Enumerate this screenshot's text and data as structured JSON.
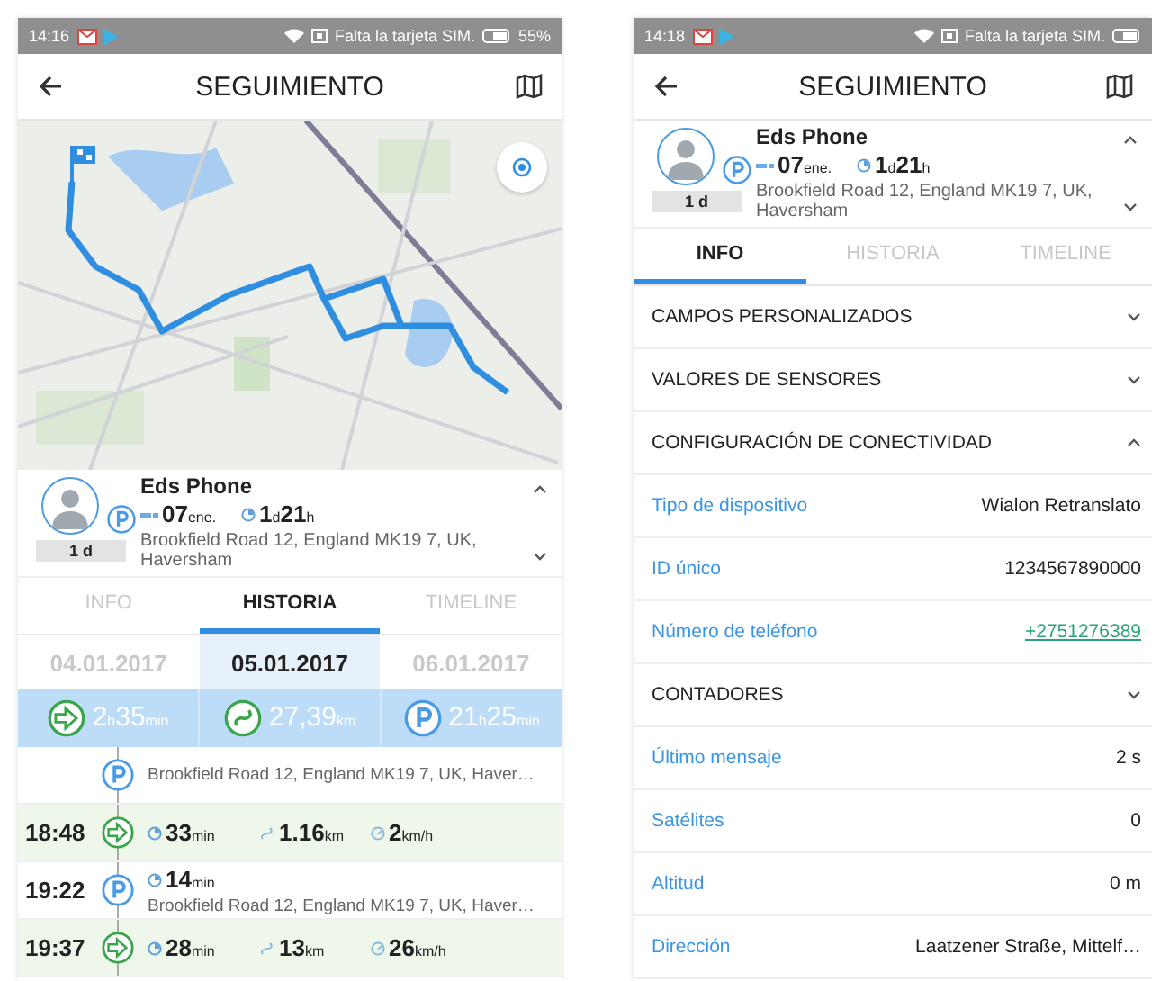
{
  "screens": [
    {
      "status_bar": {
        "time": "14:16",
        "carrier": "Falta la tarjeta SIM.",
        "battery": "55%"
      },
      "app_bar": {
        "title": "SEGUIMIENTO"
      },
      "has_map": true,
      "device": {
        "name": "Eds Phone",
        "badge": "1 d",
        "date": {
          "value": "07",
          "unit": "ene."
        },
        "duration": [
          {
            "value": "1",
            "unit": "d"
          },
          {
            "value": "21",
            "unit": "h"
          }
        ],
        "address": "Brookfield Road 12, England MK19 7, UK, Haversham"
      },
      "tabs": [
        {
          "label": "INFO",
          "selected": false
        },
        {
          "label": "HISTORIA",
          "selected": true
        },
        {
          "label": "TIMELINE",
          "selected": false
        }
      ],
      "dates": [
        {
          "label": "04.01.2017",
          "selected": false
        },
        {
          "label": "05.01.2017",
          "selected": true
        },
        {
          "label": "06.01.2017",
          "selected": false
        }
      ],
      "summary": [
        {
          "kind": "trip",
          "parts": [
            {
              "value": "2",
              "unit": "h"
            },
            {
              "value": "35",
              "unit": "min"
            }
          ]
        },
        {
          "kind": "distance",
          "parts": [
            {
              "value": "27,39",
              "unit": "km"
            }
          ]
        },
        {
          "kind": "parking",
          "parts": [
            {
              "value": "21",
              "unit": "h"
            },
            {
              "value": "25",
              "unit": "min"
            }
          ]
        }
      ],
      "timeline": [
        {
          "kind": "parking",
          "address": "Brookfield Road 12, England MK19 7, UK, Haver…"
        },
        {
          "kind": "trip",
          "time": "18:48",
          "duration": {
            "value": "33",
            "unit": "min"
          },
          "distance": {
            "value": "1.16",
            "unit": "km"
          },
          "speed": {
            "value": "2",
            "unit": "km/h"
          }
        },
        {
          "kind": "parking",
          "time": "19:22",
          "duration": {
            "value": "14",
            "unit": "min"
          },
          "address": "Brookfield Road 12, England MK19 7, UK, Haver…"
        },
        {
          "kind": "trip",
          "time": "19:37",
          "duration": {
            "value": "28",
            "unit": "min"
          },
          "distance": {
            "value": "13",
            "unit": "km"
          },
          "speed": {
            "value": "26",
            "unit": "km/h"
          }
        }
      ]
    },
    {
      "status_bar": {
        "time": "14:18",
        "carrier": "Falta la tarjeta SIM."
      },
      "app_bar": {
        "title": "SEGUIMIENTO"
      },
      "has_map": false,
      "device": {
        "name": "Eds Phone",
        "badge": "1 d",
        "date": {
          "value": "07",
          "unit": "ene."
        },
        "duration": [
          {
            "value": "1",
            "unit": "d"
          },
          {
            "value": "21",
            "unit": "h"
          }
        ],
        "address": "Brookfield Road 12, England MK19 7, UK, Haversham"
      },
      "tabs": [
        {
          "label": "INFO",
          "selected": true
        },
        {
          "label": "HISTORIA",
          "selected": false
        },
        {
          "label": "TIMELINE",
          "selected": false
        }
      ],
      "sections": [
        {
          "kind": "section",
          "title": "CAMPOS PERSONALIZADOS",
          "expanded": false
        },
        {
          "kind": "section",
          "title": "VALORES DE SENSORES",
          "expanded": false
        },
        {
          "kind": "section",
          "title": "CONFIGURACIÓN DE CONECTIVIDAD",
          "expanded": true
        },
        {
          "kind": "field",
          "label": "Tipo de dispositivo",
          "value": "Wialon Retranslato",
          "link": false
        },
        {
          "kind": "field",
          "label": "ID único",
          "value": "1234567890000",
          "link": false
        },
        {
          "kind": "field",
          "label": "Número de teléfono",
          "value": "+2751276389",
          "link": true
        },
        {
          "kind": "section",
          "title": "CONTADORES",
          "expanded": false
        },
        {
          "kind": "field",
          "label": "Último mensaje",
          "value": "2 s",
          "link": false
        },
        {
          "kind": "field",
          "label": "Satélites",
          "value": "0",
          "link": false
        },
        {
          "kind": "field",
          "label": "Altitud",
          "value": "0 m",
          "link": false
        },
        {
          "kind": "field",
          "label": "Dirección",
          "value": "Laatzener Straße, Mittelf…",
          "link": false
        }
      ]
    }
  ]
}
